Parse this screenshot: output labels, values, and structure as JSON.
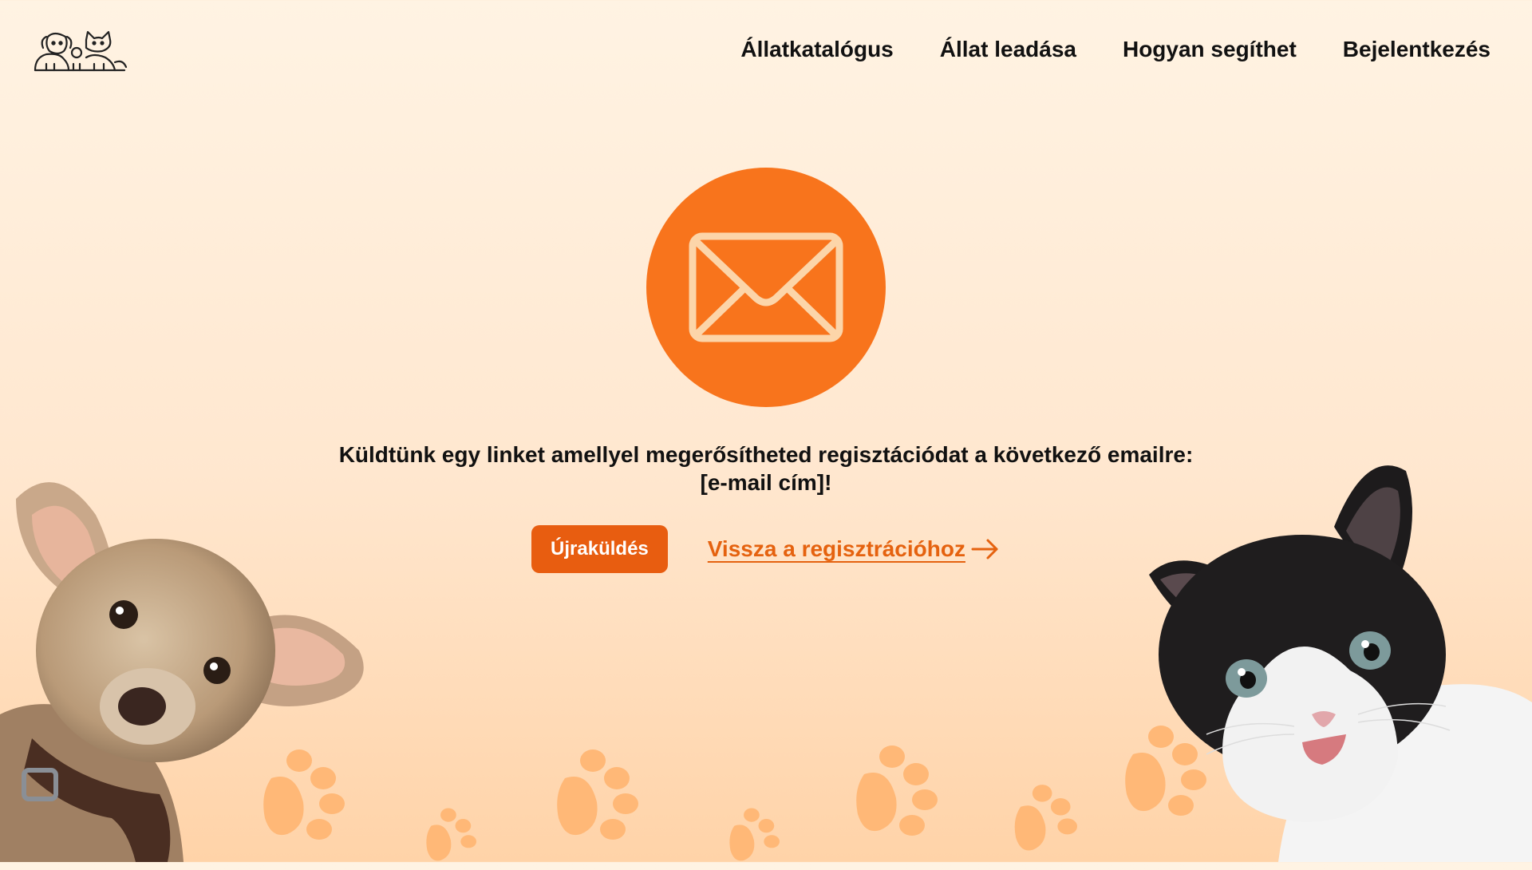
{
  "header": {
    "logo_icon": "dog-and-cat-logo-icon",
    "nav": [
      {
        "label": "Állatkatalógus"
      },
      {
        "label": "Állat leadása"
      },
      {
        "label": "Hogyan segíthet"
      },
      {
        "label": "Bejelentkezés"
      }
    ]
  },
  "main": {
    "icon": "envelope-icon",
    "message_line1": "Küldtünk egy linket amellyel megerősítheted regisztációdat a következő emailre:",
    "message_line2": "[e-mail cím]!",
    "resend_label": "Újraküldés",
    "back_label": "Vissza a regisztrációhoz",
    "back_icon": "arrow-right-icon"
  },
  "decor": {
    "left_image": "puppy-image",
    "right_image": "kitten-image",
    "paws": "paw-print-icon"
  },
  "colors": {
    "accent": "#f8741c",
    "button": "#e85d10",
    "link": "#e5620f",
    "paw": "#ffb877",
    "envelope_stroke": "#fcd5a9"
  }
}
